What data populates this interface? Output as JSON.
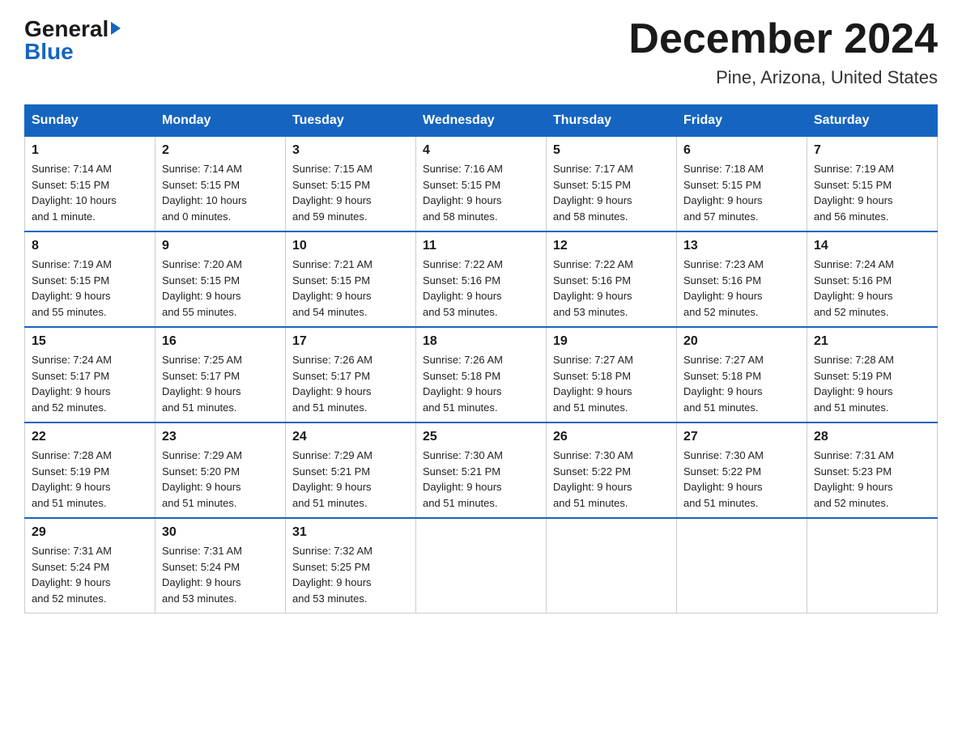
{
  "logo": {
    "line1_general": "General",
    "triangle": "▲",
    "line2": "Blue"
  },
  "title": "December 2024",
  "subtitle": "Pine, Arizona, United States",
  "days_of_week": [
    "Sunday",
    "Monday",
    "Tuesday",
    "Wednesday",
    "Thursday",
    "Friday",
    "Saturday"
  ],
  "weeks": [
    [
      {
        "num": "1",
        "info": "Sunrise: 7:14 AM\nSunset: 5:15 PM\nDaylight: 10 hours\nand 1 minute."
      },
      {
        "num": "2",
        "info": "Sunrise: 7:14 AM\nSunset: 5:15 PM\nDaylight: 10 hours\nand 0 minutes."
      },
      {
        "num": "3",
        "info": "Sunrise: 7:15 AM\nSunset: 5:15 PM\nDaylight: 9 hours\nand 59 minutes."
      },
      {
        "num": "4",
        "info": "Sunrise: 7:16 AM\nSunset: 5:15 PM\nDaylight: 9 hours\nand 58 minutes."
      },
      {
        "num": "5",
        "info": "Sunrise: 7:17 AM\nSunset: 5:15 PM\nDaylight: 9 hours\nand 58 minutes."
      },
      {
        "num": "6",
        "info": "Sunrise: 7:18 AM\nSunset: 5:15 PM\nDaylight: 9 hours\nand 57 minutes."
      },
      {
        "num": "7",
        "info": "Sunrise: 7:19 AM\nSunset: 5:15 PM\nDaylight: 9 hours\nand 56 minutes."
      }
    ],
    [
      {
        "num": "8",
        "info": "Sunrise: 7:19 AM\nSunset: 5:15 PM\nDaylight: 9 hours\nand 55 minutes."
      },
      {
        "num": "9",
        "info": "Sunrise: 7:20 AM\nSunset: 5:15 PM\nDaylight: 9 hours\nand 55 minutes."
      },
      {
        "num": "10",
        "info": "Sunrise: 7:21 AM\nSunset: 5:15 PM\nDaylight: 9 hours\nand 54 minutes."
      },
      {
        "num": "11",
        "info": "Sunrise: 7:22 AM\nSunset: 5:16 PM\nDaylight: 9 hours\nand 53 minutes."
      },
      {
        "num": "12",
        "info": "Sunrise: 7:22 AM\nSunset: 5:16 PM\nDaylight: 9 hours\nand 53 minutes."
      },
      {
        "num": "13",
        "info": "Sunrise: 7:23 AM\nSunset: 5:16 PM\nDaylight: 9 hours\nand 52 minutes."
      },
      {
        "num": "14",
        "info": "Sunrise: 7:24 AM\nSunset: 5:16 PM\nDaylight: 9 hours\nand 52 minutes."
      }
    ],
    [
      {
        "num": "15",
        "info": "Sunrise: 7:24 AM\nSunset: 5:17 PM\nDaylight: 9 hours\nand 52 minutes."
      },
      {
        "num": "16",
        "info": "Sunrise: 7:25 AM\nSunset: 5:17 PM\nDaylight: 9 hours\nand 51 minutes."
      },
      {
        "num": "17",
        "info": "Sunrise: 7:26 AM\nSunset: 5:17 PM\nDaylight: 9 hours\nand 51 minutes."
      },
      {
        "num": "18",
        "info": "Sunrise: 7:26 AM\nSunset: 5:18 PM\nDaylight: 9 hours\nand 51 minutes."
      },
      {
        "num": "19",
        "info": "Sunrise: 7:27 AM\nSunset: 5:18 PM\nDaylight: 9 hours\nand 51 minutes."
      },
      {
        "num": "20",
        "info": "Sunrise: 7:27 AM\nSunset: 5:18 PM\nDaylight: 9 hours\nand 51 minutes."
      },
      {
        "num": "21",
        "info": "Sunrise: 7:28 AM\nSunset: 5:19 PM\nDaylight: 9 hours\nand 51 minutes."
      }
    ],
    [
      {
        "num": "22",
        "info": "Sunrise: 7:28 AM\nSunset: 5:19 PM\nDaylight: 9 hours\nand 51 minutes."
      },
      {
        "num": "23",
        "info": "Sunrise: 7:29 AM\nSunset: 5:20 PM\nDaylight: 9 hours\nand 51 minutes."
      },
      {
        "num": "24",
        "info": "Sunrise: 7:29 AM\nSunset: 5:21 PM\nDaylight: 9 hours\nand 51 minutes."
      },
      {
        "num": "25",
        "info": "Sunrise: 7:30 AM\nSunset: 5:21 PM\nDaylight: 9 hours\nand 51 minutes."
      },
      {
        "num": "26",
        "info": "Sunrise: 7:30 AM\nSunset: 5:22 PM\nDaylight: 9 hours\nand 51 minutes."
      },
      {
        "num": "27",
        "info": "Sunrise: 7:30 AM\nSunset: 5:22 PM\nDaylight: 9 hours\nand 51 minutes."
      },
      {
        "num": "28",
        "info": "Sunrise: 7:31 AM\nSunset: 5:23 PM\nDaylight: 9 hours\nand 52 minutes."
      }
    ],
    [
      {
        "num": "29",
        "info": "Sunrise: 7:31 AM\nSunset: 5:24 PM\nDaylight: 9 hours\nand 52 minutes."
      },
      {
        "num": "30",
        "info": "Sunrise: 7:31 AM\nSunset: 5:24 PM\nDaylight: 9 hours\nand 53 minutes."
      },
      {
        "num": "31",
        "info": "Sunrise: 7:32 AM\nSunset: 5:25 PM\nDaylight: 9 hours\nand 53 minutes."
      },
      null,
      null,
      null,
      null
    ]
  ]
}
